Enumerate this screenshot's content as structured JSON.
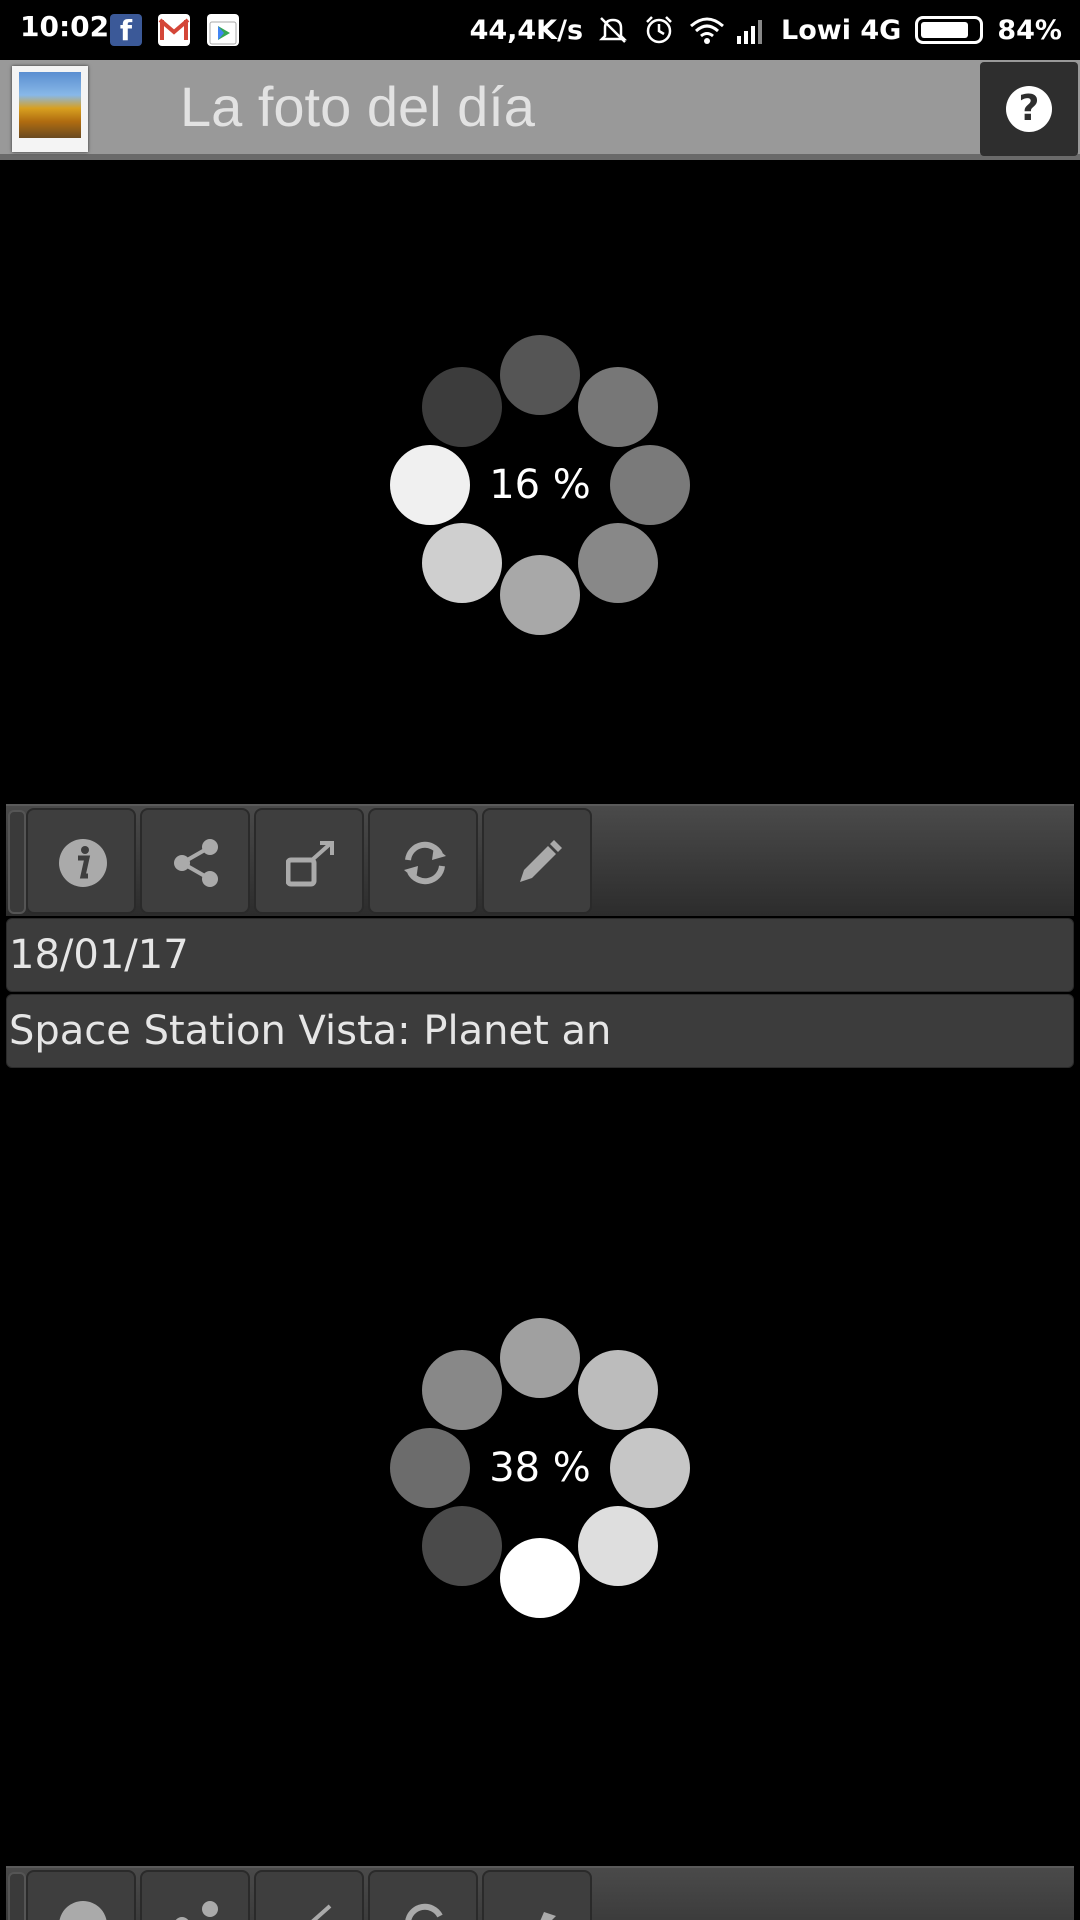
{
  "status_bar": {
    "time": "10:02",
    "speed": "44,4K/s",
    "carrier": "Lowi 4G",
    "battery": "84%",
    "battery_level": 0.84,
    "icons": [
      "facebook-icon",
      "gmail-icon",
      "play-store-icon",
      "mute-icon",
      "alarm-icon",
      "wifi-icon",
      "signal-icon",
      "battery-icon"
    ]
  },
  "app_bar": {
    "title": "La foto del día",
    "help_icon": "?"
  },
  "photos": [
    {
      "loading_percent": "16 %",
      "date": "18/01/17",
      "title": "Space Station Vista: Planet an"
    },
    {
      "loading_percent": "38 %"
    }
  ],
  "toolbar": {
    "buttons": [
      "info-icon",
      "share-icon",
      "open-external-icon",
      "refresh-icon",
      "edit-icon"
    ]
  },
  "colors": {
    "app_bar_bg": "#999999",
    "toolbar_bg": "#3e3e3e",
    "panel_bg": "#000000"
  }
}
